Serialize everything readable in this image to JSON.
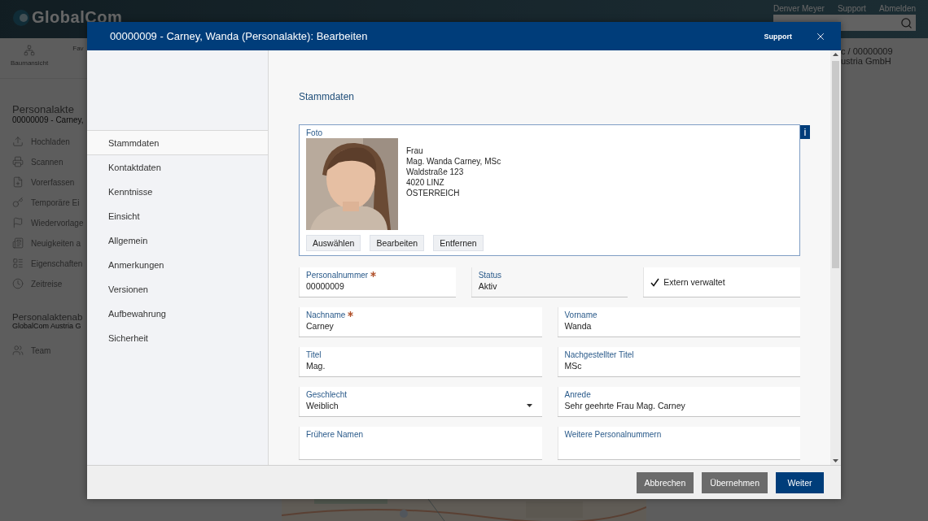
{
  "background": {
    "logo": "GlobalCom",
    "user_links": [
      "Denver Meyer",
      "Support",
      "Abmelden"
    ],
    "toolbar": [
      {
        "label": "Baumansicht",
        "kind": "tree"
      },
      {
        "label": "Fav",
        "kind": "none"
      }
    ],
    "breadcrumb": [
      "c / 00000009",
      "ustria GmbH"
    ],
    "section": {
      "title": "Personalakte",
      "subtitle": "00000009 - Carney,"
    },
    "nav": [
      {
        "label": "Hochladen",
        "kind": "upload"
      },
      {
        "label": "Scannen",
        "kind": "scan"
      },
      {
        "label": "Vorerfassen",
        "kind": "draft"
      },
      {
        "label": "Temporäre Ei",
        "kind": "key"
      },
      {
        "label": "Wiedervorlage",
        "kind": "flag"
      },
      {
        "label": "Neuigkeiten a",
        "kind": "news"
      },
      {
        "label": "Eigenschaften",
        "kind": "props"
      },
      {
        "label": "Zeitreise",
        "kind": "clock"
      }
    ],
    "group": {
      "title": "Personalaktenab",
      "subtitle": "GlobalCom Austria G"
    },
    "team": {
      "label": "Team",
      "kind": "team"
    }
  },
  "dialog": {
    "title": "00000009 - Carney, Wanda (Personalakte): Bearbeiten",
    "support": "Support",
    "sidebar": [
      {
        "label": "Stammdaten",
        "selected": true
      },
      {
        "label": "Kontaktdaten",
        "selected": false
      },
      {
        "label": "Kenntnisse",
        "selected": false
      },
      {
        "label": "Einsicht",
        "selected": false
      },
      {
        "label": "Allgemein",
        "selected": false
      },
      {
        "label": "Anmerkungen",
        "selected": false
      },
      {
        "label": "Versionen",
        "selected": false
      },
      {
        "label": "Aufbewahrung",
        "selected": false
      },
      {
        "label": "Sicherheit",
        "selected": false
      }
    ],
    "heading": "Stammdaten",
    "photo": {
      "label": "Foto",
      "info": "i",
      "address": [
        "Frau",
        "Mag. Wanda Carney, MSc",
        "Waldstraße 123",
        "4020 LINZ",
        "ÖSTERREICH"
      ],
      "buttons": [
        "Auswählen",
        "Bearbeiten",
        "Entfernen"
      ]
    },
    "field_rows": [
      [
        {
          "kind": "text",
          "label": "Personalnummer",
          "value": "00000009",
          "required": true
        },
        {
          "kind": "readonly",
          "label": "Status",
          "value": "Aktiv",
          "required": false
        },
        {
          "kind": "checkbox",
          "label": "Extern verwaltet",
          "checked": true
        }
      ],
      [
        {
          "kind": "text",
          "label": "Nachname",
          "value": "Carney",
          "required": true
        },
        {
          "kind": "text",
          "label": "Vorname",
          "value": "Wanda",
          "required": false
        }
      ],
      [
        {
          "kind": "text",
          "label": "Titel",
          "value": "Mag.",
          "required": false
        },
        {
          "kind": "text",
          "label": "Nachgestellter Titel",
          "value": "MSc",
          "required": false
        }
      ],
      [
        {
          "kind": "select",
          "label": "Geschlecht",
          "value": "Weiblich",
          "required": false
        },
        {
          "kind": "text",
          "label": "Anrede",
          "value": "Sehr geehrte Frau Mag. Carney",
          "required": false
        }
      ],
      [
        {
          "kind": "text",
          "label": "Frühere Namen",
          "required": false
        },
        {
          "kind": "text",
          "label": "Weitere Personalnummern",
          "required": false
        }
      ]
    ],
    "footer": [
      {
        "label": "Abbrechen",
        "kind": "secondary"
      },
      {
        "label": "Übernehmen",
        "kind": "secondary"
      },
      {
        "label": "Weiter",
        "kind": "primary"
      }
    ]
  }
}
